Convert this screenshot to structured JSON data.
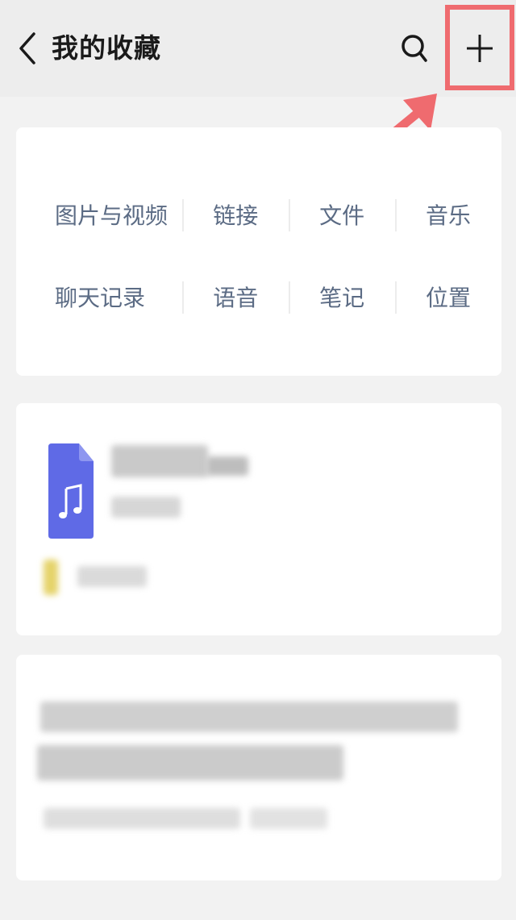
{
  "header": {
    "title": "我的收藏",
    "back_icon": "chevron-left-icon",
    "search_icon": "search-icon",
    "add_icon": "plus-icon",
    "highlight_color": "#ef6b6f"
  },
  "categories": [
    {
      "label": "图片与视频"
    },
    {
      "label": "链接"
    },
    {
      "label": "文件"
    },
    {
      "label": "音乐"
    },
    {
      "label": "聊天记录"
    },
    {
      "label": "语音"
    },
    {
      "label": "笔记"
    },
    {
      "label": "位置"
    }
  ],
  "colors": {
    "category_text": "#5b6b84",
    "music_icon": "#5f6ae6",
    "background": "#f2f2f2"
  }
}
